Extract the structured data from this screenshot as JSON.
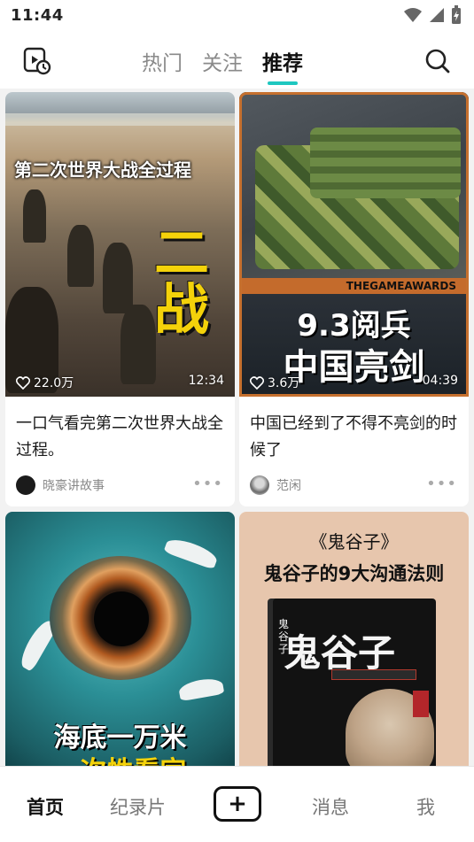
{
  "status_bar": {
    "time": "11:44"
  },
  "top_nav": {
    "tabs": [
      {
        "label": "热门",
        "active": false
      },
      {
        "label": "关注",
        "active": false
      },
      {
        "label": "推荐",
        "active": true
      }
    ]
  },
  "colors": {
    "accent": "#1ec7c0"
  },
  "feed": {
    "cards": [
      {
        "thumb_caption": "第二次世界大战全过程",
        "thumb_big_text": "二战",
        "likes": "22.0万",
        "duration": "12:34",
        "title": "一口气看完第二次世界大战全过程。",
        "author": "晓豪讲故事"
      },
      {
        "thumb_strip": "THEGAMEAWARDS",
        "thumb_line1": "9.3阅兵",
        "thumb_line2": "中国亮剑",
        "likes": "3.6万",
        "duration": "04:39",
        "title": "中国已经到了不得不亮剑的时候了",
        "author": "范闲"
      },
      {
        "thumb_caption": "海底一万米",
        "thumb_caption2": "一次性看完"
      },
      {
        "thumb_heading": "《鬼谷子》",
        "thumb_subheading": "鬼谷子的9大沟通法则",
        "book_title": "鬼谷子",
        "book_spine": "鬼谷子"
      }
    ]
  },
  "bottom_nav": {
    "items": [
      {
        "label": "首页",
        "active": true
      },
      {
        "label": "纪录片",
        "active": false
      },
      {
        "label": "消息",
        "active": false
      },
      {
        "label": "我",
        "active": false
      }
    ],
    "publish_symbol": "+"
  }
}
